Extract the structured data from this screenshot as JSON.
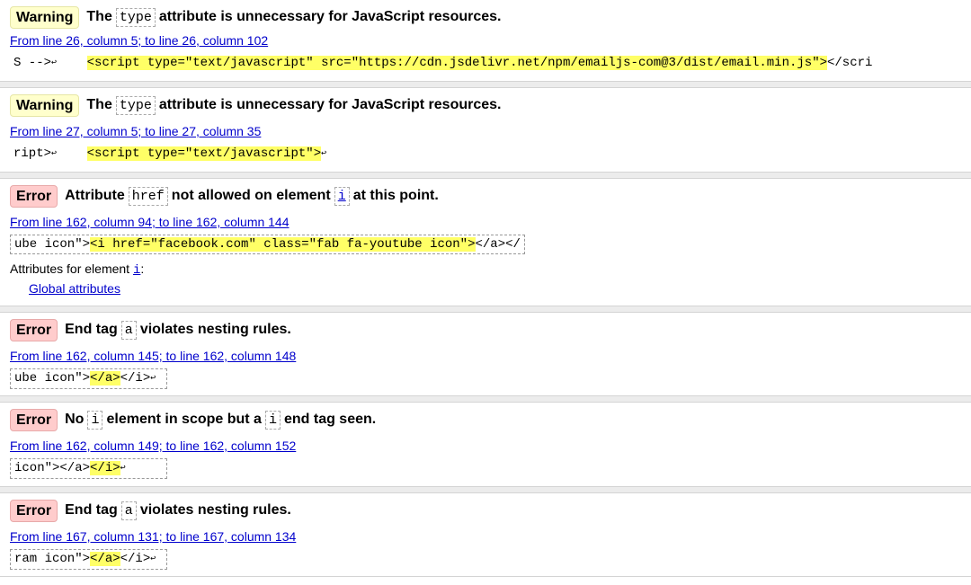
{
  "messages": [
    {
      "type": "Warning",
      "pre": "The",
      "code": "type",
      "post": "attribute is unnecessary for JavaScript resources.",
      "location": "From line 26, column 5; to line 26, column 102",
      "extract_before": "S -->",
      "extract_gap": "    ",
      "extract_hl": "<script type=\"text/javascript\" src=\"https://cdn.jsdelivr.net/npm/emailjs-com@3/dist/email.min.js\">",
      "extract_after": "</scri"
    },
    {
      "type": "Warning",
      "pre": "The",
      "code": "type",
      "post": "attribute is unnecessary for JavaScript resources.",
      "location": "From line 27, column 5; to line 27, column 35",
      "extract_before": "ript>",
      "extract_gap": "    ",
      "extract_hl": "<script type=\"text/javascript\">",
      "extract_after": ""
    },
    {
      "type": "Error",
      "pre": "Attribute",
      "code": "href",
      "mid": "not allowed on element",
      "code2": "i",
      "post": "at this point.",
      "location": "From line 162, column 94; to line 162, column 144",
      "extract_before": "ube icon\">",
      "extract_hl": "<i href=\"facebook.com\" class=\"fab fa-youtube icon\">",
      "extract_after": "</a></",
      "attributes_label": "Attributes for element",
      "attributes_element": "i",
      "attributes_colon": ":",
      "global_attributes": "Global attributes"
    },
    {
      "type": "Error",
      "pre": "End tag",
      "code": "a",
      "post": "violates nesting rules.",
      "location": "From line 162, column 145; to line 162, column 148",
      "extract_before": "ube icon\">",
      "extract_hl": "</a>",
      "extract_after": "</i>"
    },
    {
      "type": "Error",
      "pre": "No",
      "code": "i",
      "mid": "element in scope but a",
      "code2": "i",
      "post": "end tag seen.",
      "location": "From line 162, column 149; to line 162, column 152",
      "extract_before": "icon\"></a>",
      "extract_hl": "</i>",
      "extract_after": ""
    },
    {
      "type": "Error",
      "pre": "End tag",
      "code": "a",
      "post": "violates nesting rules.",
      "location": "From line 167, column 131; to line 167, column 134",
      "extract_before": "ram icon\">",
      "extract_hl": "</a>",
      "extract_after": "</i>"
    }
  ],
  "return_glyph": "↩",
  "colors": {
    "warning_bg": "#ffffcc",
    "error_bg": "#ffcccc",
    "highlight": "#ffff66",
    "link": "#0000cc"
  }
}
